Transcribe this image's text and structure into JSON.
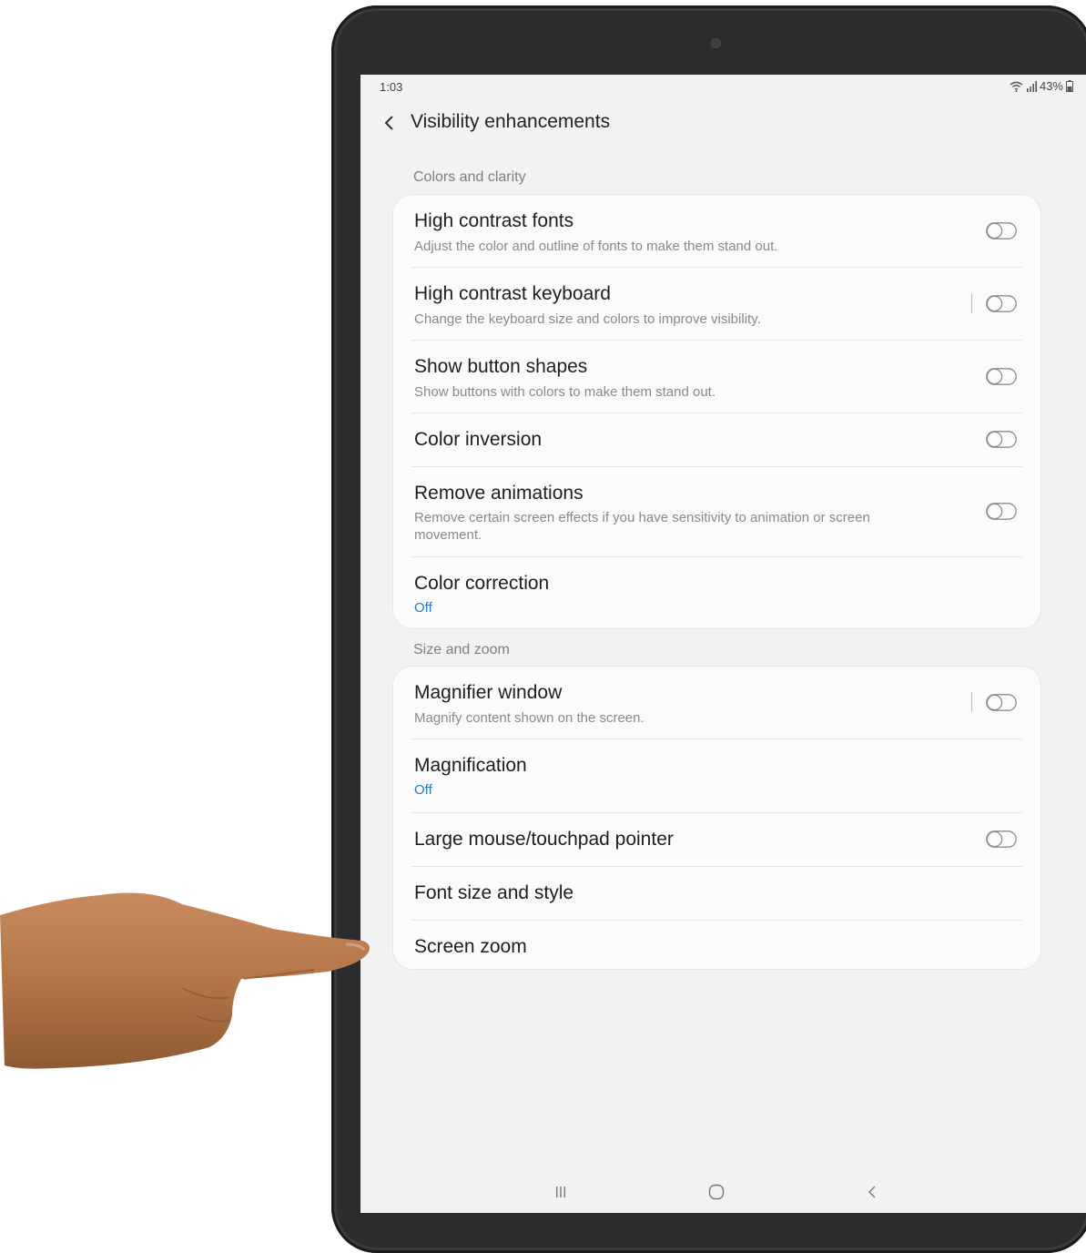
{
  "status": {
    "time": "1:03",
    "battery": "43%"
  },
  "header": {
    "title": "Visibility enhancements",
    "back_icon": "chevron-left-icon"
  },
  "sections": [
    {
      "label": "Colors and clarity",
      "items": [
        {
          "title": "High contrast fonts",
          "subtitle": "Adjust the color and outline of fonts to make them stand out.",
          "toggle": "off"
        },
        {
          "title": "High contrast keyboard",
          "subtitle": "Change the keyboard size and colors to improve visibility.",
          "toggle": "off"
        },
        {
          "title": "Show button shapes",
          "subtitle": "Show buttons with colors to make them stand out.",
          "toggle": "off"
        },
        {
          "title": "Color inversion",
          "toggle": "off"
        },
        {
          "title": "Remove animations",
          "subtitle": "Remove certain screen effects if you have sensitivity to animation or screen movement.",
          "toggle": "off"
        },
        {
          "title": "Color correction",
          "value": "Off"
        }
      ]
    },
    {
      "label": "Size and zoom",
      "items": [
        {
          "title": "Magnifier window",
          "subtitle": "Magnify content shown on the screen.",
          "toggle": "off"
        },
        {
          "title": "Magnification",
          "value": "Off"
        },
        {
          "title": "Large mouse/touchpad pointer",
          "toggle": "off"
        },
        {
          "title": "Font size and style"
        },
        {
          "title": "Screen zoom"
        }
      ]
    }
  ],
  "navbar": {
    "recents_icon": "recents-icon",
    "home_icon": "home-icon",
    "back_icon": "back-icon"
  },
  "colors": {
    "accent": "#2a7bc4",
    "background": "#f2f2f2",
    "card": "#fbfbfb"
  }
}
